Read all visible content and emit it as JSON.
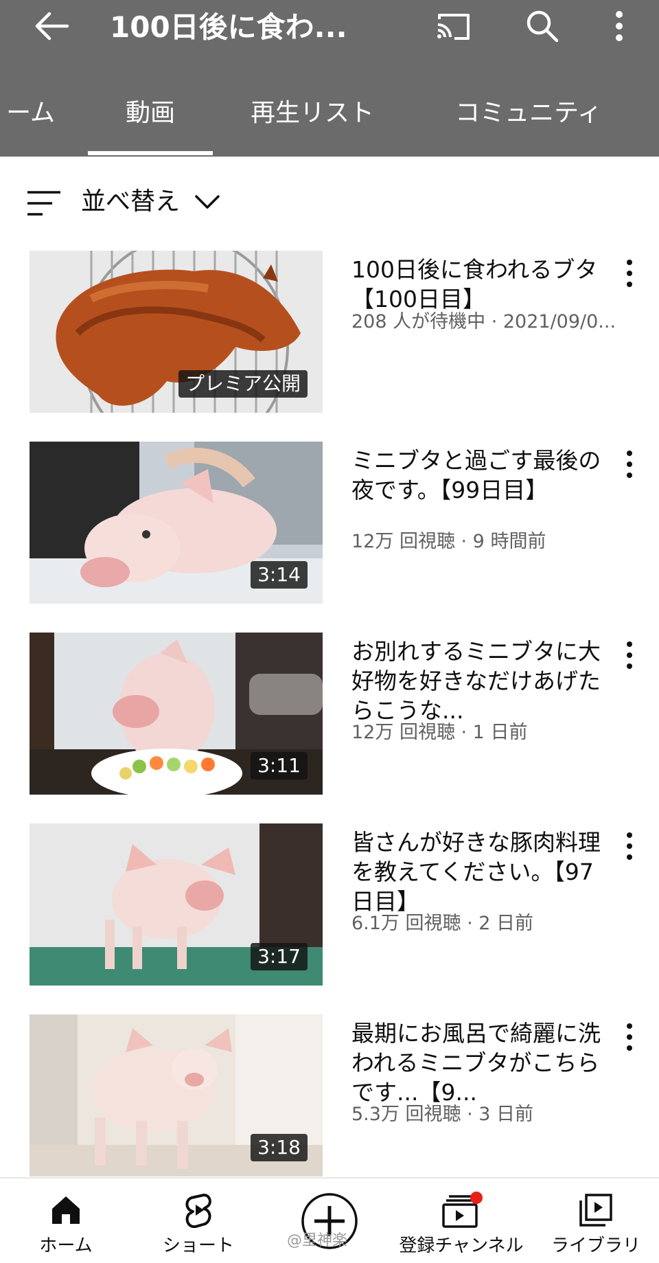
{
  "header": {
    "title": "100日後に食わ...",
    "back_icon": "arrow-left-icon",
    "cast_icon": "cast-icon",
    "search_icon": "search-icon",
    "more_icon": "more-vert-icon",
    "background": "#6b6b6b"
  },
  "tabs": [
    {
      "label": "ーム"
    },
    {
      "label": "動画",
      "selected": true
    },
    {
      "label": "再生リスト"
    },
    {
      "label": "コミュニティ"
    }
  ],
  "sort": {
    "label": "並べ替え"
  },
  "videos": [
    {
      "title": "100日後に食われるブタ【100日目】",
      "meta": "208 人が待機中 · 2021/09/0...",
      "badge": "プレミア公開"
    },
    {
      "title": "ミニブタと過ごす最後の夜です。【99日目】",
      "meta": "12万 回視聴 · 9 時間前",
      "badge": "3:14"
    },
    {
      "title": "お別れするミニブタに大好物を好きなだけあげたらこうな...",
      "meta": "12万 回視聴 · 1 日前",
      "badge": "3:11"
    },
    {
      "title": "皆さんが好きな豚肉料理を教えてください。【97日目】",
      "meta": "6.1万 回視聴 · 2 日前",
      "badge": "3:17"
    },
    {
      "title": "最期にお風呂で綺麗に洗われるミニブタがこちらです...【9...",
      "meta": "5.3万 回視聴 · 3 日前",
      "badge": "3:18"
    }
  ],
  "bottom_nav": [
    {
      "label": "ホーム",
      "icon": "home-icon"
    },
    {
      "label": "ショート",
      "icon": "shorts-icon"
    },
    {
      "label": "",
      "icon": "create-plus-icon"
    },
    {
      "label": "登録チャンネル",
      "icon": "subscriptions-icon",
      "notification": true
    },
    {
      "label": "ライブラリ",
      "icon": "library-icon"
    }
  ],
  "watermark": "@里神楽"
}
